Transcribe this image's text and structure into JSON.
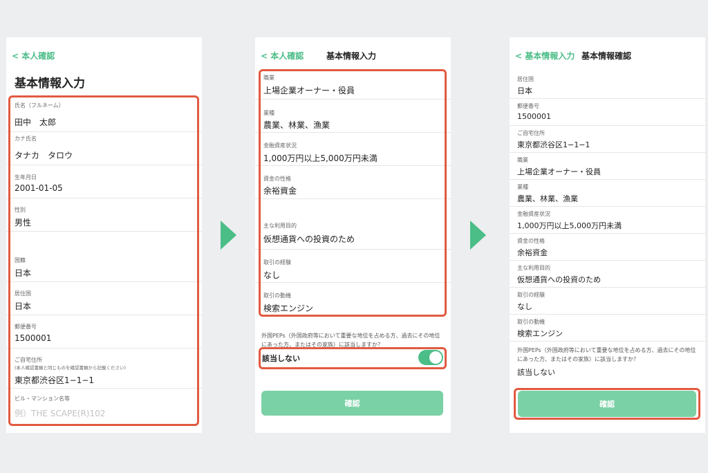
{
  "colors": {
    "accent": "#4bbd87",
    "highlight": "#e15a40",
    "button": "#7bd1a6"
  },
  "p1": {
    "back_label": "本人確認",
    "title": "基本情報入力",
    "fields": [
      {
        "label": "氏名（フルネーム）",
        "value": "田中　太郎"
      },
      {
        "label": "カナ氏名",
        "value": "タナカ　タロウ"
      },
      {
        "label": "生年月日",
        "value": "2001-01-05"
      },
      {
        "label": "性別",
        "value": "男性"
      },
      {
        "label": "国籍",
        "value": "日本"
      },
      {
        "label": "居住国",
        "value": "日本"
      },
      {
        "label": "郵便番号",
        "value": "1500001"
      },
      {
        "label": "ご自宅住所",
        "sublabel": "(本人確認書類と同じものを確認書類から記載ください)",
        "value": "東京都渋谷区1−1−1"
      },
      {
        "label": "ビル・マンション名等",
        "placeholder": "例）THE SCAPE(R)102"
      }
    ]
  },
  "p2": {
    "back_label": "本人確認",
    "title": "基本情報入力",
    "fields": [
      {
        "label": "職業",
        "value": "上場企業オーナー・役員"
      },
      {
        "label": "業種",
        "value": "農業、林業、漁業"
      },
      {
        "label": "金融資産状況",
        "value": "1,000万円以上5,000万円未満"
      },
      {
        "label": "資金の性格",
        "value": "余裕資金"
      },
      {
        "label": "主な利用目的",
        "value": "仮想通貨への投資のため"
      },
      {
        "label": "取引の経験",
        "value": "なし"
      },
      {
        "label": "取引の動機",
        "value": "検索エンジン"
      }
    ],
    "pep_question": "外国PEPs（外国政府等において重要な地位を占める方、過去にその地位にあった方、またはその家族）に該当しますか？",
    "pep_answer": "該当しない",
    "confirm_label": "確認"
  },
  "p3": {
    "back_label": "基本情報入力",
    "title": "基本情報確認",
    "fields": [
      {
        "label": "居住国",
        "value": "日本"
      },
      {
        "label": "郵便番号",
        "value": "1500001"
      },
      {
        "label": "ご自宅住所",
        "value": "東京都渋谷区1−1−1"
      },
      {
        "label": "職業",
        "value": "上場企業オーナー・役員"
      },
      {
        "label": "業種",
        "value": "農業、林業、漁業"
      },
      {
        "label": "金融資産状況",
        "value": "1,000万円以上5,000万円未満"
      },
      {
        "label": "資金の性格",
        "value": "余裕資金"
      },
      {
        "label": "主な利用目的",
        "value": "仮想通貨への投資のため"
      },
      {
        "label": "取引の経験",
        "value": "なし"
      },
      {
        "label": "取引の動機",
        "value": "検索エンジン"
      }
    ],
    "pep_question": "外国PEPs（外国政府等において重要な地位を占める方、過去にその地位にあった方、またはその家族）に該当しますか？",
    "pep_answer": "該当しない",
    "confirm_label": "確認"
  }
}
